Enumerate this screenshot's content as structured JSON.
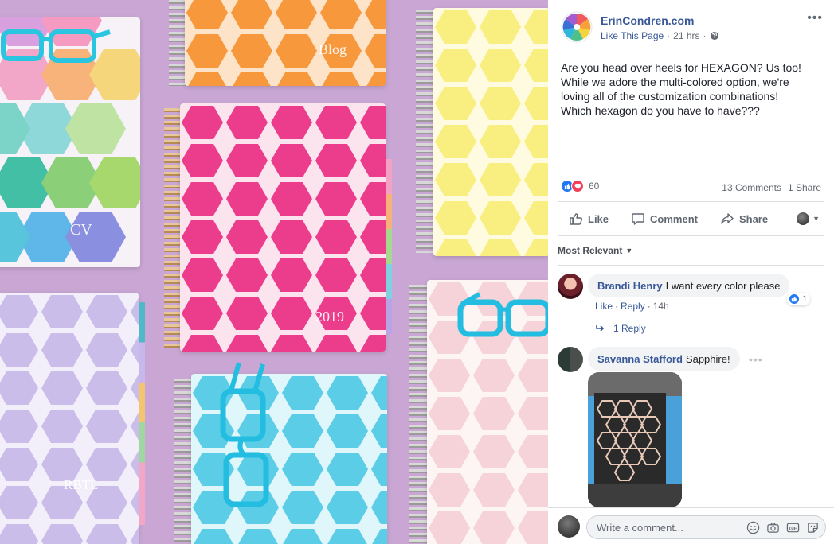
{
  "post": {
    "page_name": "ErinCondren.com",
    "like_page": "Like This Page",
    "separator": "·",
    "time": "21 hrs",
    "text": "Are you head over heels for HEXAGON? Us too!\nWhile we adore the multi-colored option, we're\nloving all of the customization combinations!\nWhich hexagon do you have to have???",
    "reaction_count": "60",
    "comments_count": "13 Comments",
    "shares_count": "1 Share"
  },
  "actions": {
    "like": "Like",
    "comment": "Comment",
    "share": "Share"
  },
  "sort_label": "Most Relevant",
  "comments": [
    {
      "author": "Brandi Henry",
      "text": "I want every color please",
      "like_label": "Like",
      "reply_label": "Reply",
      "time": "14h",
      "reaction_count": "1",
      "replies_label": "1 Reply"
    },
    {
      "author": "Savanna Stafford",
      "text": "Sapphire!"
    }
  ],
  "composer": {
    "placeholder": "Write a comment..."
  },
  "photo": {
    "covers": [
      "Blog",
      "CV",
      "2019",
      "RBTL"
    ]
  },
  "colors": {
    "link": "#385898",
    "muted": "#616770",
    "like_blue": "#2078f4",
    "love_red": "#f33e58",
    "bubble": "#f2f3f5",
    "photo_bg": "#c9a6d3"
  }
}
